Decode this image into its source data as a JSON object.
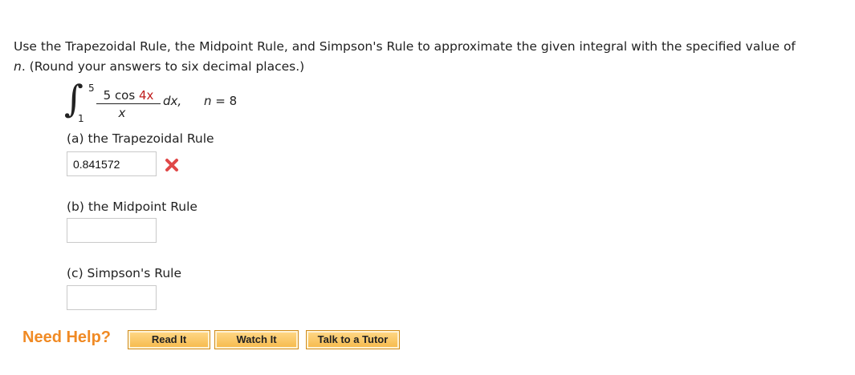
{
  "problem": {
    "intro": "Use the Trapezoidal Rule, the Midpoint Rule, and Simpson's Rule to approximate the given integral with the specified value of",
    "n_var": "n",
    "intro_end": ". (Round your answers to six decimal places.)"
  },
  "integral": {
    "sign": "∫",
    "upper_limit": "5",
    "lower_limit": "1",
    "numerator_coeff": "5",
    "numerator_func": " cos ",
    "numerator_arg": "4x",
    "denominator": "x",
    "differential": "dx,",
    "n_label": "n",
    "n_equals": " = 8"
  },
  "parts": [
    {
      "label": "(a) the Trapezoidal Rule",
      "value": "0.841572",
      "status": "incorrect"
    },
    {
      "label": "(b) the Midpoint Rule",
      "value": ""
    },
    {
      "label": "(c) Simpson's Rule",
      "value": ""
    }
  ],
  "help": {
    "title": "Need Help?",
    "buttons": [
      "Read It",
      "Watch It",
      "Talk to a Tutor"
    ]
  },
  "colors": {
    "accent_orange": "#f08a24",
    "error_red": "#e04848",
    "highlight_red": "#c01d1d"
  }
}
